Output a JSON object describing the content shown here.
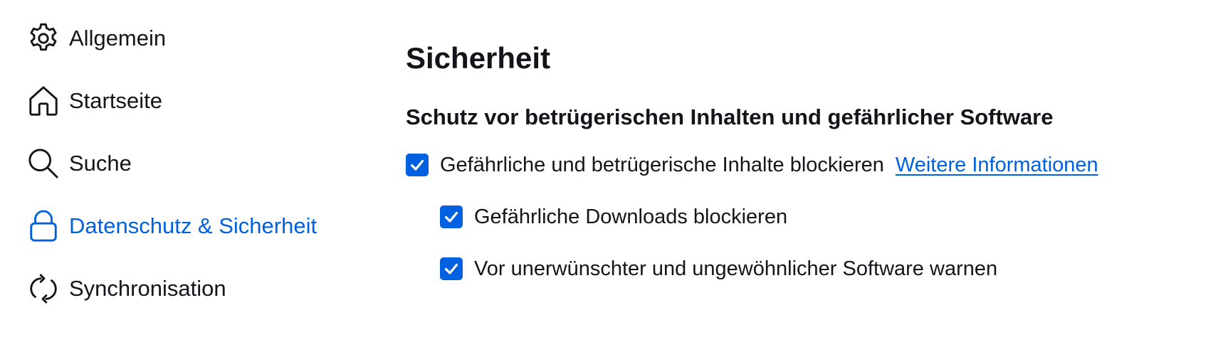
{
  "sidebar": {
    "items": [
      {
        "label": "Allgemein",
        "icon": "gear-icon",
        "active": false
      },
      {
        "label": "Startseite",
        "icon": "home-icon",
        "active": false
      },
      {
        "label": "Suche",
        "icon": "search-icon",
        "active": false
      },
      {
        "label": "Datenschutz & Sicherheit",
        "icon": "lock-icon",
        "active": true
      },
      {
        "label": "Synchronisation",
        "icon": "sync-icon",
        "active": false
      }
    ]
  },
  "main": {
    "title": "Sicherheit",
    "section_title": "Schutz vor betrügerischen Inhalten und gefährlicher Software",
    "options": [
      {
        "label": "Gefährliche und betrügerische Inhalte blockieren",
        "checked": true,
        "link": "Weitere Informationen"
      },
      {
        "label": "Gefährliche Downloads blockieren",
        "checked": true
      },
      {
        "label": "Vor unerwünschter und ungewöhnlicher Software warnen",
        "checked": true
      }
    ]
  },
  "colors": {
    "accent": "#0061e0",
    "text": "#15141a",
    "background": "#ffffff"
  }
}
